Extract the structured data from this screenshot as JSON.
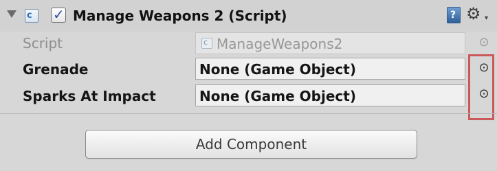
{
  "component": {
    "title": "Manage Weapons 2 (Script)",
    "enabled": true,
    "icons": {
      "foldout": "foldout-arrow-icon",
      "script": "csharp-script-icon",
      "help": "help-book-icon",
      "settings": "gear-icon"
    }
  },
  "properties": [
    {
      "label": "Script",
      "value": "ManageWeapons2"
    },
    {
      "label": "Grenade",
      "value": "None (Game Object)"
    },
    {
      "label": "Sparks At Impact",
      "value": "None (Game Object)"
    }
  ],
  "add_component_label": "Add Component",
  "highlight_color": "#c9595a"
}
